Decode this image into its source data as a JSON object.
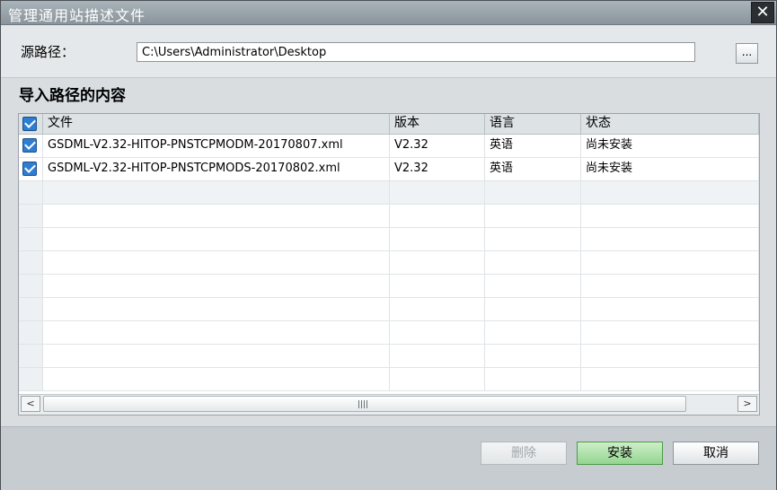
{
  "window": {
    "title": "管理通用站描述文件",
    "close_glyph": "✕"
  },
  "source": {
    "label": "源路径：",
    "path": "C:\\Users\\Administrator\\Desktop",
    "browse_label": "..."
  },
  "content": {
    "title": "导入路径的内容",
    "columns": [
      "文件",
      "版本",
      "语言",
      "状态"
    ],
    "all_checked": true,
    "rows": [
      {
        "checked": true,
        "file": "GSDML-V2.32-HITOP-PNSTCPMODM-20170807.xml",
        "version": "V2.32",
        "language": "英语",
        "status": "尚未安装"
      },
      {
        "checked": true,
        "file": "GSDML-V2.32-HITOP-PNSTCPMODS-20170802.xml",
        "version": "V2.32",
        "language": "英语",
        "status": "尚未安装"
      }
    ]
  },
  "scrollbar": {
    "left_glyph": "<",
    "right_glyph": ">"
  },
  "buttons": {
    "delete": "删除",
    "install": "安装",
    "cancel": "取消"
  },
  "colors": {
    "titlebar": "#8a949c",
    "install_button": "#93d58f",
    "checkbox": "#2e7dd1"
  }
}
